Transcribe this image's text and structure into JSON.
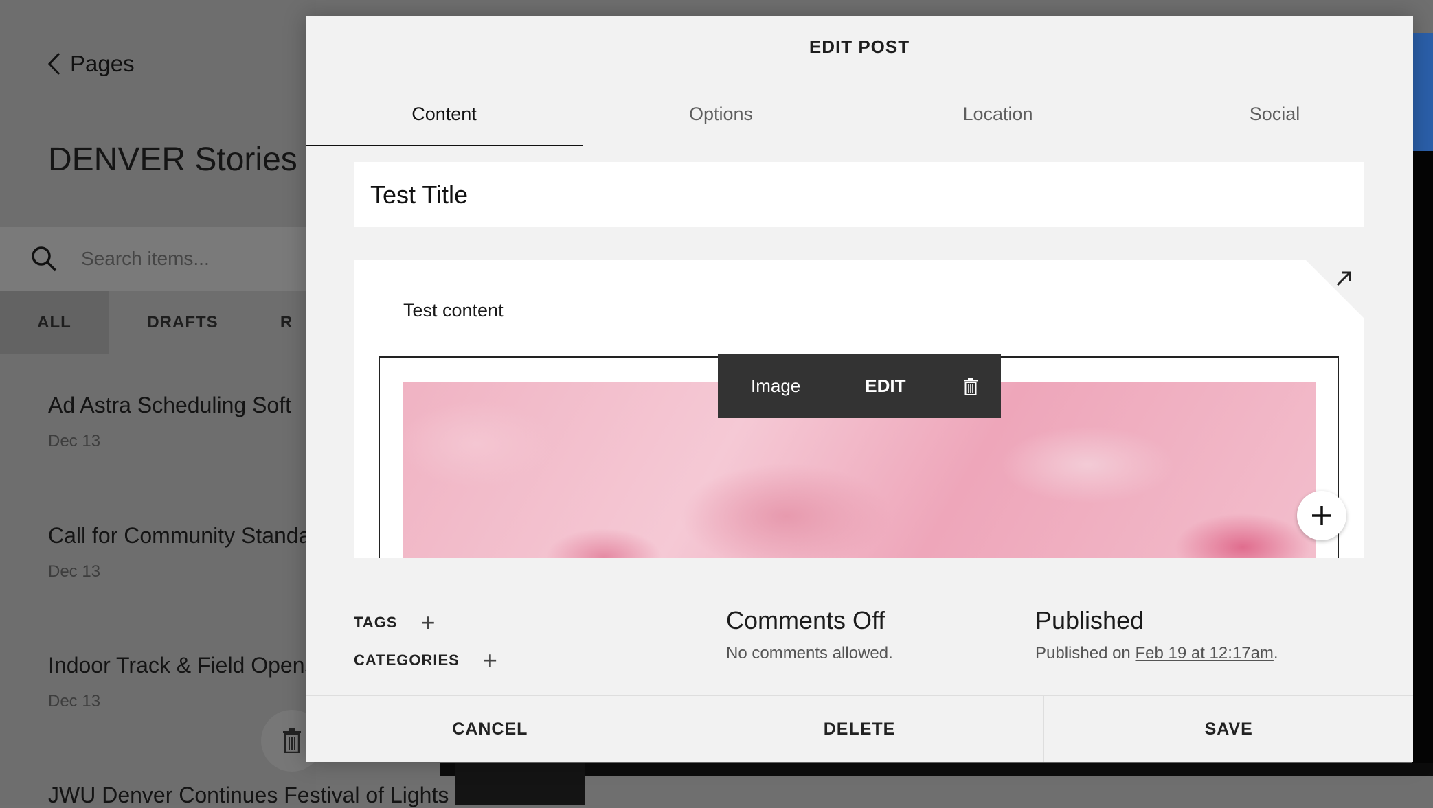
{
  "background": {
    "back_label": "Pages",
    "site_title": "DENVER Stories",
    "search_placeholder": "Search items...",
    "filters": [
      "ALL",
      "DRAFTS",
      "R"
    ],
    "items": [
      {
        "title": "Ad Astra Scheduling Soft",
        "date": "Dec 13"
      },
      {
        "title": "Call for Community Standard",
        "date": "Dec 13"
      },
      {
        "title": "Indoor Track & Field Opens S",
        "date": "Dec 13"
      },
      {
        "title": "JWU Denver Continues Festival of Lights ...",
        "date": ""
      }
    ]
  },
  "modal": {
    "title": "EDIT POST",
    "tabs": [
      "Content",
      "Options",
      "Location",
      "Social"
    ],
    "post_title": "Test Title",
    "content_text": "Test content",
    "image_toolbar": {
      "label": "Image",
      "edit": "EDIT"
    },
    "tags_label": "TAGS",
    "categories_label": "CATEGORIES",
    "comments": {
      "heading": "Comments Off",
      "sub": "No comments allowed."
    },
    "published": {
      "heading": "Published",
      "prefix": "Published on ",
      "date": "Feb 19 at 12:17am",
      "suffix": "."
    },
    "footer": {
      "cancel": "CANCEL",
      "delete": "DELETE",
      "save": "SAVE"
    }
  }
}
